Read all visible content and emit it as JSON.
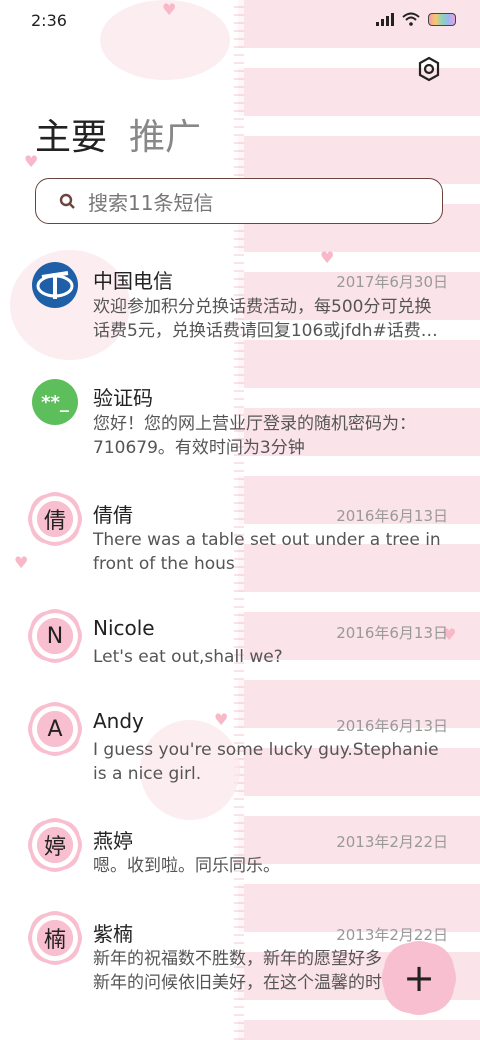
{
  "status_bar": {
    "time": "2:36"
  },
  "tabs": {
    "primary": "主要",
    "promotions": "推广"
  },
  "search": {
    "placeholder": "搜索11条短信"
  },
  "conversations": [
    {
      "name": "中国电信",
      "date": "2017年6月30日",
      "snippet": "欢迎参加积分兑换话费活动，每500分可兑换\n话费5元，兑换话费请回复106或jfdh#话费…",
      "avatar": "telecom-logo"
    },
    {
      "name": "验证码",
      "date": "",
      "snippet": "您好！您的网上营业厅登录的随机密码为：\n710679。有效时间为3分钟",
      "avatar_text": "**_"
    },
    {
      "name": "倩倩",
      "date": "2016年6月13日",
      "snippet": "There was a table set out under a tree in\nfront of the hous",
      "avatar_text": "倩"
    },
    {
      "name": "Nicole",
      "date": "2016年6月13日",
      "snippet": "Let's eat out,shall we?",
      "avatar_text": "N"
    },
    {
      "name": "Andy",
      "date": "2016年6月13日",
      "snippet": "I guess you're some lucky guy.Stephanie\nis a nice girl.",
      "avatar_text": "A"
    },
    {
      "name": "燕婷",
      "date": "2013年2月22日",
      "snippet": "嗯。收到啦。同乐同乐。",
      "avatar_text": "婷"
    },
    {
      "name": "紫楠",
      "date": "2013年2月22日",
      "snippet": "新年的祝福数不胜数，新年的愿望好多\n新年的问候依旧美好，在这个温馨的时",
      "avatar_text": "楠"
    }
  ],
  "fab": {
    "label": "+"
  },
  "colors": {
    "accent_pink": "#f8bfd0",
    "stripe_pink": "#fbe3ea",
    "verify_green": "#5cbf5c",
    "telecom_blue": "#1f5fa8"
  }
}
